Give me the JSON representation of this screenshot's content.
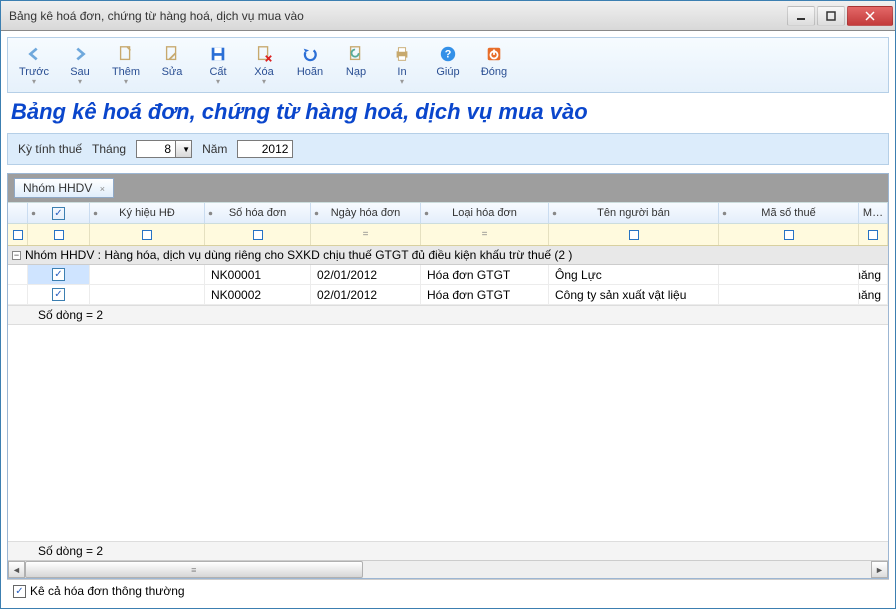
{
  "window": {
    "title": "Bảng kê hoá đơn, chứng từ hàng hoá, dịch vụ mua vào"
  },
  "toolbar": [
    {
      "id": "prev",
      "label": "Trước"
    },
    {
      "id": "next",
      "label": "Sau"
    },
    {
      "id": "add",
      "label": "Thêm"
    },
    {
      "id": "edit",
      "label": "Sửa"
    },
    {
      "id": "save",
      "label": "Cất"
    },
    {
      "id": "delete",
      "label": "Xóa"
    },
    {
      "id": "undo",
      "label": "Hoãn"
    },
    {
      "id": "reload",
      "label": "Nạp"
    },
    {
      "id": "print",
      "label": "In"
    },
    {
      "id": "help",
      "label": "Giúp"
    },
    {
      "id": "close",
      "label": "Đóng"
    }
  ],
  "page_title": "Bảng kê hoá đơn, chứng từ hàng hoá, dịch vụ mua vào",
  "filter": {
    "period_label": "Kỳ tính thuế",
    "month_label": "Tháng",
    "month_value": "8",
    "year_label": "Năm",
    "year_value": "2012"
  },
  "group_chip": {
    "label": "Nhóm HHDV",
    "close": "×"
  },
  "columns": {
    "kh": "Ký hiệu HĐ",
    "so": "Số hóa đơn",
    "ngay": "Ngày hóa đơn",
    "loai": "Loại hóa đơn",
    "ten": "Tên người bán",
    "mst": "Mã số thuế",
    "last": "M…"
  },
  "group_header": "Nhóm HHDV : Hàng hóa, dịch vụ dùng riêng cho SXKD chịu thuế GTGT đủ điều kiện khấu trừ thuế (2 )",
  "rows": [
    {
      "checked": true,
      "kh": "",
      "so": "NK00001",
      "ngay": "02/01/2012",
      "loai": "Hóa đơn GTGT",
      "ten": "Ông Lực",
      "mst": "",
      "last": "Xi măng"
    },
    {
      "checked": true,
      "kh": "",
      "so": "NK00002",
      "ngay": "02/01/2012",
      "loai": "Hóa đơn GTGT",
      "ten": "Công ty sản xuất vật liệu",
      "mst": "",
      "last": "Xi măng"
    }
  ],
  "summary_group": "Số dòng = 2",
  "summary_bottom": "Số dòng = 2",
  "footer": {
    "label": "Kê cả hóa đơn thông thường",
    "checked": true
  }
}
